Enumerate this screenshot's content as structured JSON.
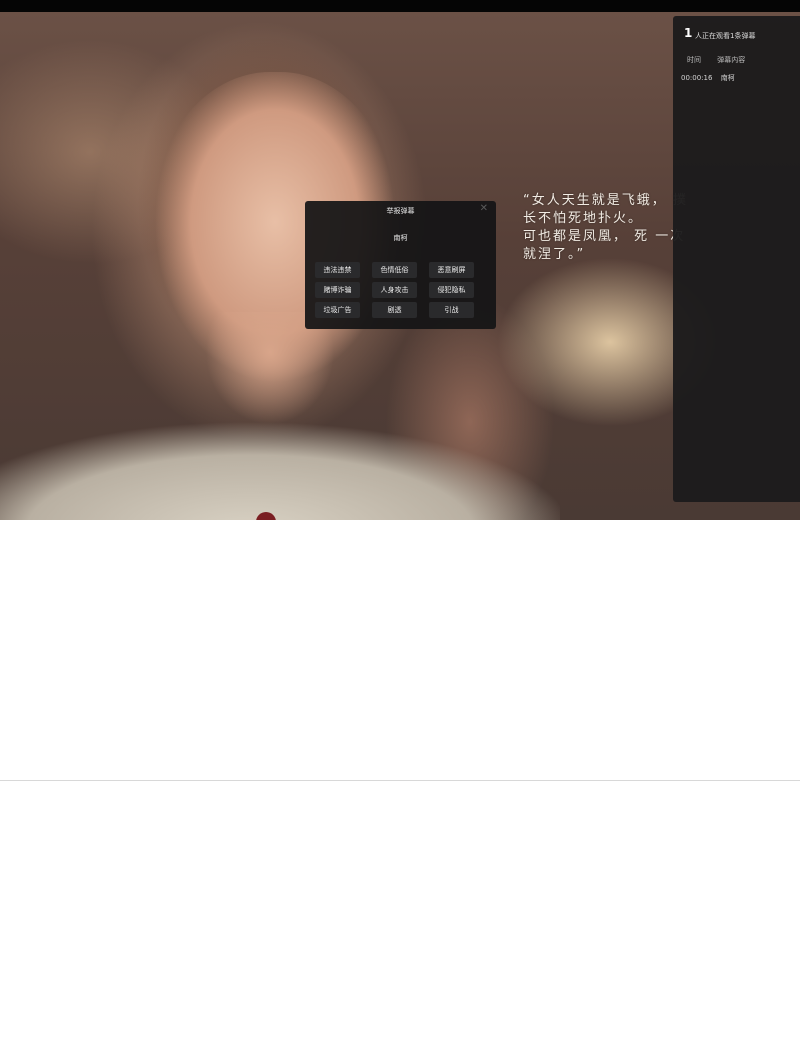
{
  "subtitle": {
    "line1": "“女人天生就是飞蛾，   撲",
    "line2": "长不怕死地扑火。",
    "line3": "    可也都是凤凰，  死 一次",
    "line4": "就涅了。”"
  },
  "danmaku_panel": {
    "viewer_count": "1",
    "viewer_text": "人正在观看1条弹幕",
    "columns": [
      "时间",
      "弹幕内容"
    ],
    "rows": [
      {
        "time": "00:00:16",
        "content": "南柯"
      }
    ]
  },
  "report_dialog": {
    "title": "举报弹幕",
    "close_icon": "close-icon",
    "username": "南柯",
    "reasons": [
      "违法违禁",
      "色情低俗",
      "恶意刷屏",
      "赌博诈骗",
      "人身攻击",
      "侵犯隐私",
      "垃圾广告",
      "剧透",
      "引战"
    ]
  },
  "colors": {
    "panel_bg": "#1c1b1c",
    "dialog_bg": "#141416",
    "button_bg": "#2a2a2c"
  }
}
